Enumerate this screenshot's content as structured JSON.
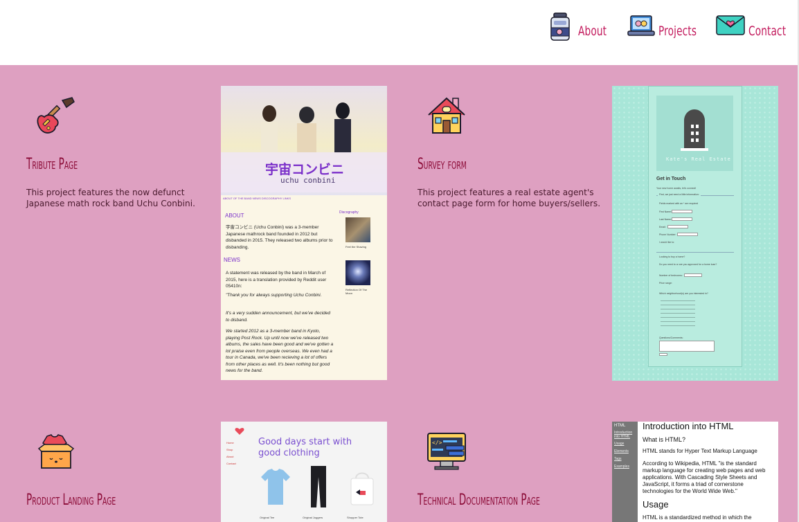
{
  "nav": {
    "items": [
      {
        "label": "About",
        "icon": "jar-icon"
      },
      {
        "label": "Projects",
        "icon": "laptop-icon"
      },
      {
        "label": "Contact",
        "icon": "envelope-icon"
      }
    ]
  },
  "colors": {
    "background": "#dea0c1",
    "header": "#ffffff",
    "title": "#8b0a36",
    "nav": "#c2185b"
  },
  "projects": [
    {
      "title": "Tribute Page",
      "icon": "electric-guitar-icon",
      "description": "This project features the now defunct Japanese math rock band Uchu Conbini.",
      "thumbnail": {
        "heading_jp": "宇宙コンビニ",
        "heading_en": "uchu conbini",
        "links": "ABOUT OF THE BAND  NEWS  DISCOGRAPHY  LINKS",
        "about_heading": "ABOUT",
        "about_text": "宇宙コンビニ (Uchu Conbini) was a 3-member Japanese mathrock band founded in 2012 but disbanded in 2015. They released two albums prior to disbanding.",
        "news_heading": "NEWS",
        "news_text": "A statement was released by the band in March of 2015, here is a translation provided by Reddit user 05410n:",
        "quote_1": "\"Thank you for always supporting Uchu Conbini.",
        "quote_2": "It's a very sudden announcement, but we've decided to disband.",
        "quote_3": "We started 2012 as a 3-member band in Kyoto, playing Post Rock. Up until now we've released two albums, the sales have been good and we've gotten a lot praise even from people overseas. We even had a tour in Canada, we've been recieving a lot of offers from other places as well. It's been nothing but good news for the band.",
        "discography_heading": "Discography",
        "album_1": "Feel the Shaving",
        "album_2": "Reflection Of The Moon"
      }
    },
    {
      "title": "Survey form",
      "icon": "house-icon",
      "description": "This project features a real estate agent's contact page form for home buyers/sellers.",
      "thumbnail": {
        "brand": "Kate's Real Estate",
        "heading": "Get in Touch",
        "rows": [
          "Your new home awaits, let's connect!",
          "First, we just need a little information:",
          "Fields marked with an * are required",
          "First Name:",
          "Last Name:",
          "Email:",
          "Phone Number:",
          "I would like to:",
          "Looking to buy a home?",
          "Do you need to or are you approved for a home loan?",
          "Number of bedrooms:",
          "Price range:",
          "Which neighborhood(s) are you interested in?",
          "Questions/Comments:"
        ]
      }
    },
    {
      "title": "Product Landing Page",
      "icon": "box-clothes-icon",
      "description": "",
      "thumbnail": {
        "headline": "Good days start with good clothing",
        "nav": [
          "Home",
          "Shop",
          "About",
          "Contact"
        ],
        "items": [
          "Original Tee",
          "Original Joggers",
          "Shopper Tote"
        ]
      }
    },
    {
      "title": "Technical Documentation Page",
      "icon": "code-screen-icon",
      "description": "",
      "thumbnail": {
        "side_title": "HTML",
        "side_links": [
          "Introduction into HTML",
          "Usage",
          "Elements",
          "Tags",
          "Examples"
        ],
        "h1": "Introduction into HTML",
        "h2": "What is HTML?",
        "p1": "HTML stands for Hyper Text Markup Language",
        "p2": "According to Wikipedia, HTML \"is the standard markup language for creating web pages and web applications. With Cascading Style Sheets and JavaScript, it forms a triad of cornerstone technologies for the World Wide Web.\"",
        "h3": "Usage",
        "p3": "HTML is a standardized method in which the"
      }
    }
  ]
}
